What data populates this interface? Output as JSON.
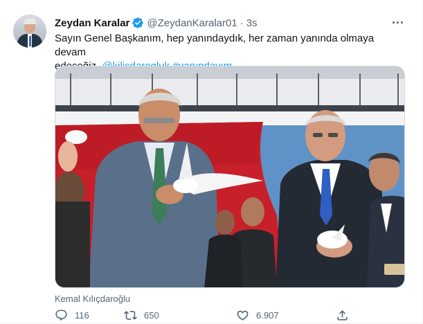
{
  "author": {
    "display_name": "Zeydan Karalar",
    "handle": "@ZeydanKaralar01",
    "separator": "·",
    "time": "3s"
  },
  "tweet": {
    "text_line1": "Sayın Genel Başkanım, hep yanındaydık, her zaman yanında olmaya devam",
    "text_line2_start": "edeceğiz. ",
    "mention": "@kilicdarogluk",
    "hashtag": "#yanındayım"
  },
  "media": {
    "tagged_person": "Kemal Kılıçdaroğlu"
  },
  "actions": {
    "reply_count": "116",
    "retweet_count": "650",
    "like_count": "6.907"
  },
  "colors": {
    "link": "#1d9bf0",
    "secondary_text": "#536471",
    "verified": "#1d9bf0"
  },
  "icons": [
    "verified-badge-icon",
    "more-dots-icon",
    "reply-icon",
    "retweet-icon",
    "like-icon",
    "share-icon"
  ]
}
